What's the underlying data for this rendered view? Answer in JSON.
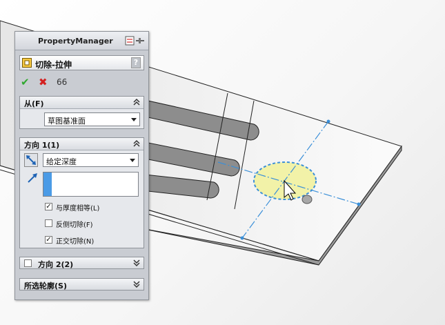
{
  "panel": {
    "title": "PropertyManager",
    "feature_name": "切除-拉伸",
    "help_label": "?",
    "actions": {
      "ok": "✔",
      "cancel": "✖",
      "preview": "66"
    }
  },
  "from_group": {
    "title": "从(F)",
    "start_condition": "草图基准面"
  },
  "direction1": {
    "title": "方向 1(1)",
    "end_condition": "给定深度",
    "depth_value": "",
    "options": [
      {
        "label": "与厚度相等(L)",
        "checked": true
      },
      {
        "label": "反侧切除(F)",
        "checked": false
      },
      {
        "label": "正交切除(N)",
        "checked": true
      }
    ]
  },
  "direction2": {
    "title": "方向 2(2)",
    "checked": false
  },
  "selected_contours": {
    "title": "所选轮廓(S)"
  },
  "colors": {
    "panel_bg": "#c9ccd2",
    "accent_blue": "#4b9be6",
    "sketch_circle": "#f2f2a8",
    "centerline": "#3a8fd8"
  }
}
